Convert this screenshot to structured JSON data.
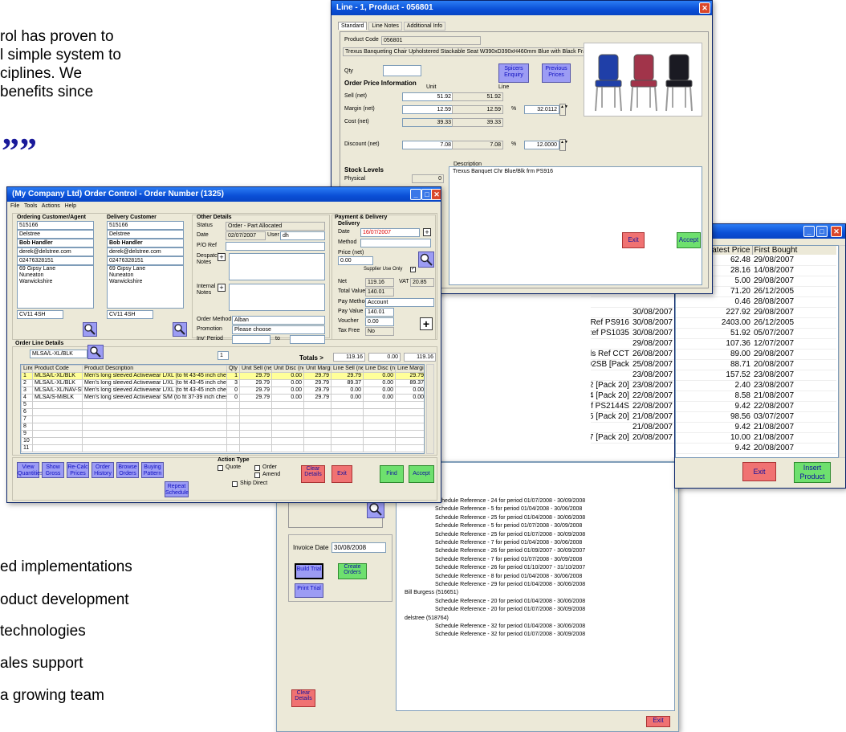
{
  "slide": {
    "quote_lines": [
      "rol has proven to",
      "l simple system to",
      "ciplines.  We",
      "benefits since"
    ],
    "quote_mark": "”",
    "bullets": [
      "ed implementations",
      "oduct development",
      "technologies",
      "ales support",
      "a growing team"
    ]
  },
  "line_window": {
    "title": "Line - 1, Product - 056801",
    "tabs": [
      "Standard",
      "Line Notes",
      "Additional Info"
    ],
    "product_code_label": "Product Code",
    "product_code": "056801",
    "product_desc": "Trexus Banqueting Chair Upholstered Stackable Seat W390xD390xH460mm Blue with Black Frame Ref",
    "qty_label": "Qty",
    "qty": "",
    "spicers_enquiry": "Spicers Enquiry",
    "previous_prices": "Previous Prices",
    "order_price_info": "Order Price Information",
    "unit_hdr": "Unit",
    "line_hdr": "Line",
    "rows": [
      {
        "label": "Sell (net)",
        "unit": "51.92",
        "line": "51.92",
        "pct": ""
      },
      {
        "label": "Margin (net)",
        "unit": "12.59",
        "line": "12.59",
        "pct": "32.0112"
      },
      {
        "label": "Cost (net)",
        "unit": "39.33",
        "line": "39.33",
        "pct": ""
      },
      {
        "label": "Discount (net)",
        "unit": "7.08",
        "line": "7.08",
        "pct": "12.0000"
      }
    ],
    "pct_sign": "%",
    "stock_levels": "Stock Levels",
    "physical_label": "Physical",
    "physical": "0",
    "description_label": "Description",
    "description": "Trexus Banquet Chr Blue/Blk frm PS916",
    "exit": "Exit",
    "accept": "Accept",
    "chair_colors": [
      "#1f3fa8",
      "#a1344a",
      "#1a1a22"
    ]
  },
  "products_window": {
    "columns": [
      "Latest Price",
      "First Bought"
    ],
    "rows": [
      {
        "desc": "",
        "date": "",
        "price": "62.48",
        "first": "29/08/2007"
      },
      {
        "desc": "",
        "date": "",
        "price": "28.16",
        "first": "14/08/2007"
      },
      {
        "desc": "",
        "date": "",
        "price": "5.00",
        "first": "29/08/2007"
      },
      {
        "desc": "",
        "date": "",
        "price": "71.20",
        "first": "26/12/2005"
      },
      {
        "desc": "",
        "date": "",
        "price": "0.46",
        "first": "28/08/2007"
      },
      {
        "desc": "",
        "date": "",
        "price": "227.92",
        "first": "29/08/2007"
      },
      {
        "desc": "",
        "date": "30/08/2007",
        "price": "2403.00",
        "first": "26/12/2005"
      },
      {
        "desc": "able Seat W390xD390xH460mm Blue with Black Frame Ref PS916",
        "date": "30/08/2007",
        "price": "51.92",
        "first": "05/07/2007"
      },
      {
        "desc": "l Deep-cushioned W520xD660xH790mm Blue Ref PS1035",
        "date": "30/08/2007",
        "price": "107.36",
        "first": "12/07/2007"
      },
      {
        "desc": "",
        "date": "29/08/2007",
        "price": "89.00",
        "first": "29/08/2007"
      },
      {
        "desc": "hairs with Steel Frame 2 Rubber Wheels Ref CCT",
        "date": "26/08/2007",
        "price": "88.71",
        "first": "20/08/2007"
      },
      {
        "desc": "Frame H1100mm Seat W420x400x450mm Blue Ref PS802SB [Pack",
        "date": "25/08/2007",
        "price": "157.52",
        "first": "23/08/2007"
      },
      {
        "desc": "",
        "date": "23/08/2007",
        "price": "2.40",
        "first": "23/08/2007"
      },
      {
        "desc": "n Point 1.0mm Black Ref 850732 [Pack 20]",
        "date": "23/08/2007",
        "price": "8.58",
        "first": "21/08/2007"
      },
      {
        "desc": "Tip 0.5mm Line Black Ref 843884 [Pack 20]",
        "date": "22/08/2007",
        "price": "9.42",
        "first": "22/08/2007"
      },
      {
        "desc": "on Castors Gas Lift Seat H480-620mm Blue Ref PS2144S",
        "date": "22/08/2007",
        "price": "98.56",
        "first": "03/07/2007"
      },
      {
        "desc": "Tip 0.5mm Line Blue Ref 843885 [Pack 20]",
        "date": "21/08/2007",
        "price": "9.42",
        "first": "21/08/2007"
      },
      {
        "desc": "",
        "date": "21/08/2007",
        "price": "10.00",
        "first": "21/08/2007"
      },
      {
        "desc": "Tip 0.5mm Line Red Ref 843887 [Pack 20]",
        "date": "20/08/2007",
        "price": "9.42",
        "first": "20/08/2007"
      }
    ],
    "exit": "Exit",
    "insert_product": "Insert Product"
  },
  "schedule_window": {
    "invoice_date_label": "Invoice Date",
    "invoice_date": "30/08/2008",
    "build_trial": "Build Trial",
    "create_orders": "Create Orders",
    "print_trial": "Print Trial",
    "clear_details": "Clear Details",
    "exit": "Exit",
    "tree": [
      {
        "text": "Schedule Reference - 24 for period 01/07/2008 - 30/09/2008",
        "lvl": 2
      },
      {
        "text": "Schedule Reference - 5 for period 01/04/2008 - 30/06/2008",
        "lvl": 2
      },
      {
        "text": "Schedule Reference - 25 for period 01/04/2008 - 30/06/2008",
        "lvl": 2
      },
      {
        "text": "Schedule Reference - 5 for period 01/07/2008 - 30/09/2008",
        "lvl": 2
      },
      {
        "text": "Schedule Reference - 25 for period 01/07/2008 - 30/09/2008",
        "lvl": 2
      },
      {
        "text": "Schedule Reference - 7 for period 01/04/2008 - 30/06/2008",
        "lvl": 2
      },
      {
        "text": "Schedule Reference - 26 for period 01/09/2007 - 30/09/2007",
        "lvl": 2
      },
      {
        "text": "Schedule Reference - 7 for period 01/07/2008 - 30/09/2008",
        "lvl": 2
      },
      {
        "text": "Schedule Reference - 26 for period 01/10/2007 - 31/10/2007",
        "lvl": 2
      },
      {
        "text": "Schedule Reference - 8 for period 01/04/2008 - 30/06/2008",
        "lvl": 2
      },
      {
        "text": "Schedule Reference - 29 for period 01/04/2008 - 30/06/2008",
        "lvl": 2
      },
      {
        "text": "Bill Burgess (516651)",
        "lvl": 1
      },
      {
        "text": "Schedule Reference - 20 for period 01/04/2008 - 30/06/2008",
        "lvl": 2
      },
      {
        "text": "Schedule Reference - 20 for period 01/07/2008 - 30/09/2008",
        "lvl": 2
      },
      {
        "text": "delstree (518764)",
        "lvl": 1
      },
      {
        "text": "Schedule Reference - 32 for period 01/04/2008 - 30/06/2008",
        "lvl": 2
      },
      {
        "text": "Schedule Reference - 32 for period 01/07/2008 - 30/09/2008",
        "lvl": 2
      }
    ]
  },
  "order_window": {
    "title": "(My Company Ltd) Order Control  -  Order Number (1325)",
    "menu": [
      "File",
      "Tools",
      "Actions",
      "Help"
    ],
    "ordering_hdr": "Ordering Customer/Agent",
    "delivery_hdr": "Delivery Customer",
    "ordering": [
      "515166",
      "Delstree",
      "Bob Handler",
      "derek@delstree.com",
      "02476328151"
    ],
    "delivery": [
      "515166",
      "Delstree",
      "Bob Handler",
      "derek@delstree.com",
      "02476328151"
    ],
    "address": "69 Gipsy Lane\nNuneaton\nWarwickshire",
    "postcode": "CV11 4SH",
    "other_hdr": "Other Details",
    "status_label": "Status",
    "status": "Order - Part Allocated",
    "date_label": "Date",
    "date": "02/07/2007",
    "user_label": "User",
    "user": "dh",
    "po_label": "P/O Ref",
    "despatch_label": "Despatch Notes",
    "internal_label": "Internal Notes",
    "order_method_label": "Order Method",
    "order_method": "Alban",
    "promotion_label": "Promotion",
    "promotion": "Please choose",
    "inv_period_label": "Inv' Period",
    "to_label": "to",
    "payment_hdr": "Payment & Delivery",
    "delivery_sub": "Delivery",
    "pd_date": "16/07/2007",
    "method_label": "Method",
    "price_net_label": "Price (net)",
    "price_net": "0.00",
    "supplier_use_only": "Supplier Use Only",
    "net_label": "Net",
    "net": "119.16",
    "vat_label": "VAT",
    "vat": "20.85",
    "total_value_label": "Total Value",
    "total_value": "140.01",
    "pay_method_label": "Pay Method",
    "pay_method": "Account",
    "pay_value_label": "Pay Value",
    "pay_value": "140.01",
    "voucher_label": "Voucher",
    "voucher": "0.00",
    "tax_free_label": "Tax Free",
    "tax_free": "No",
    "order_line_hdr": "Order Line Details",
    "search": "MLSA/L-XL/BLK",
    "one": "1",
    "totals_label": "Totals  >",
    "totals": [
      "119.16",
      "0.00",
      "119.16"
    ],
    "grid_cols": [
      "Line",
      "Product Code",
      "Product Description",
      "Qty",
      "Unit Sell (net)",
      "Unit Disc (net)",
      "Unit Margin",
      "Line Sell (net)",
      "Line Disc (net)",
      "Line Margin"
    ],
    "grid_rows": [
      [
        "1",
        "MLSA/L-XL/BLK",
        "Men's long sleeved Activewear L/XL (to fit 43-45 inch chest)",
        "1",
        "29.79",
        "0.00",
        "29.79",
        "29.79",
        "0.00",
        "29.79"
      ],
      [
        "2",
        "MLSA/L-XL/BLK",
        "Men's long sleeved Activewear L/XL (to fit 43-45 inch chest)",
        "3",
        "29.79",
        "0.00",
        "29.79",
        "89.37",
        "0.00",
        "89.37"
      ],
      [
        "3",
        "MLSA/L-XL/NAV-SKY",
        "Men's long sleeved Activewear L/XL (to fit 43-45 inch chest)",
        "0",
        "29.79",
        "0.00",
        "29.79",
        "0.00",
        "0.00",
        "0.00"
      ],
      [
        "4",
        "MLSA/S-M/BLK",
        "Men's long sleeved Activewear S/M (to fit 37-39 inch chest)",
        "0",
        "29.79",
        "0.00",
        "29.79",
        "0.00",
        "0.00",
        "0.00"
      ],
      [
        "5",
        "",
        "",
        "",
        "",
        "",
        "",
        "",
        "",
        ""
      ],
      [
        "6",
        "",
        "",
        "",
        "",
        "",
        "",
        "",
        "",
        ""
      ],
      [
        "7",
        "",
        "",
        "",
        "",
        "",
        "",
        "",
        "",
        ""
      ],
      [
        "8",
        "",
        "",
        "",
        "",
        "",
        "",
        "",
        "",
        ""
      ],
      [
        "9",
        "",
        "",
        "",
        "",
        "",
        "",
        "",
        "",
        ""
      ],
      [
        "10",
        "",
        "",
        "",
        "",
        "",
        "",
        "",
        "",
        ""
      ],
      [
        "11",
        "",
        "",
        "",
        "",
        "",
        "",
        "",
        "",
        ""
      ]
    ],
    "buttons": [
      "View Quantities",
      "Show Gross",
      "Re-Calc Prices",
      "Order History",
      "Browse Orders",
      "Buying Pattern"
    ],
    "repeat_schedule": "Repeat Schedule",
    "action_type": "Action Type",
    "quote": "Quote",
    "order": "Order",
    "amend": "Amend",
    "ship_direct": "Ship Direct",
    "clear_details": "Clear Details",
    "exit": "Exit",
    "find": "Find",
    "accept": "Accept"
  }
}
